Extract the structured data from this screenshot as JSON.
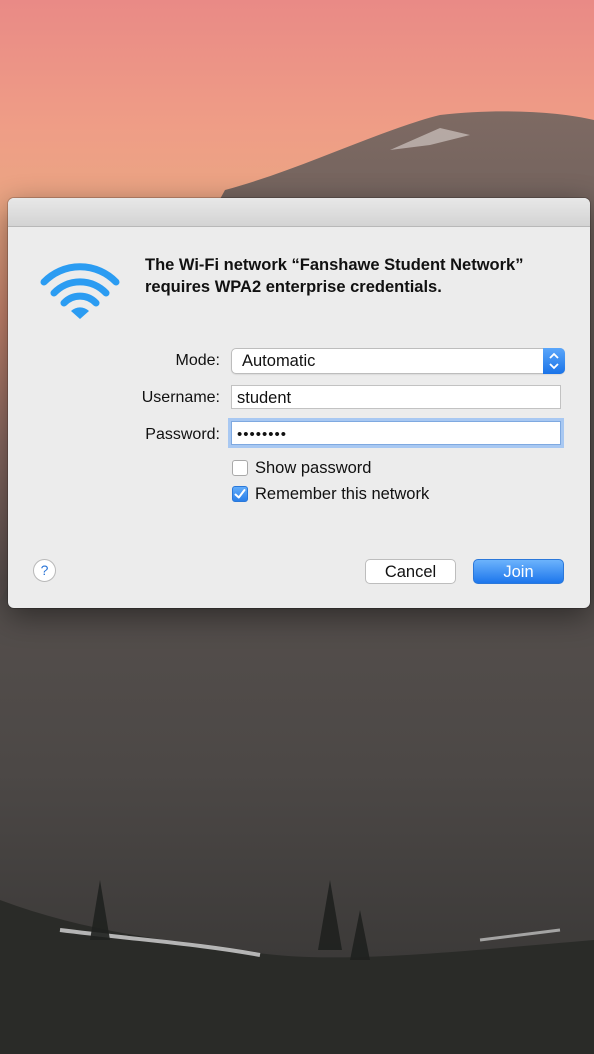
{
  "dialog": {
    "message_line1": "The Wi-Fi network “Fanshawe Student Network”",
    "message_line2": "requires WPA2 enterprise credentials.",
    "icon": "wifi-icon"
  },
  "form": {
    "mode_label": "Mode:",
    "mode_value": "Automatic",
    "username_label": "Username:",
    "username_value": "student",
    "password_label": "Password:",
    "password_value": "••••••••",
    "show_password_label": "Show password",
    "show_password_checked": false,
    "remember_label": "Remember this network",
    "remember_checked": true
  },
  "buttons": {
    "help": "?",
    "cancel": "Cancel",
    "join": "Join"
  },
  "colors": {
    "accent": "#1d76ec",
    "wifi_icon": "#2b9cf2"
  }
}
